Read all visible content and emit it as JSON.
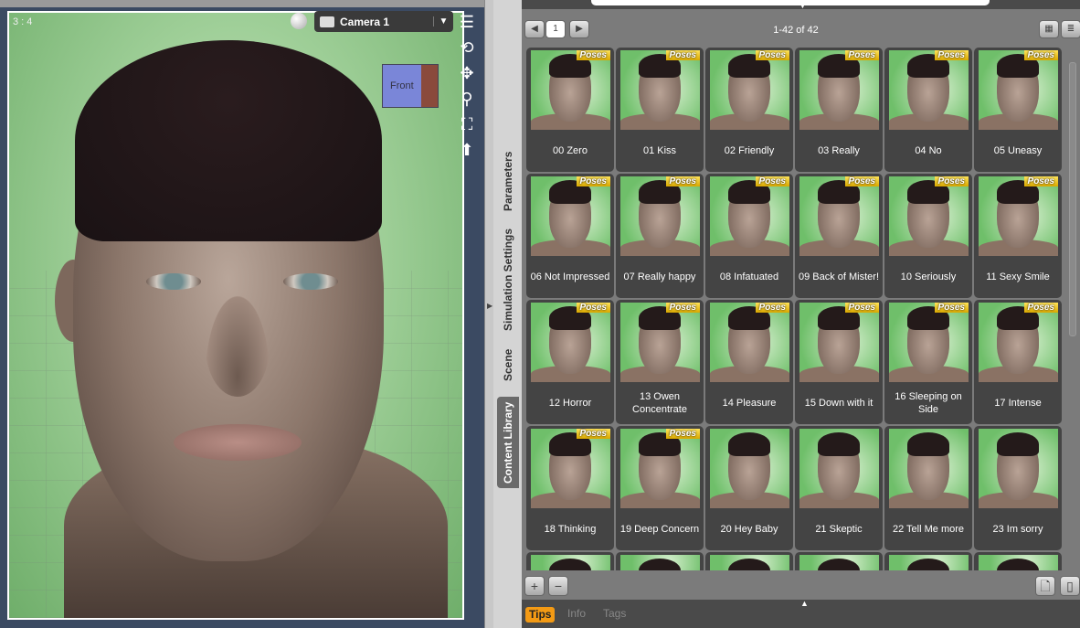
{
  "viewport": {
    "aspect_ratio": "3 : 4",
    "camera": "Camera 1",
    "nav_cube_label": "Front"
  },
  "side_tabs": [
    "Parameters",
    "Simulation Settings",
    "Scene",
    "Content Library"
  ],
  "active_side_tab": "Content Library",
  "library": {
    "page": "1",
    "count": "1-42 of 42",
    "badge": "Poses",
    "items": [
      {
        "label": "00 Zero",
        "pose": true
      },
      {
        "label": "01 Kiss",
        "pose": true
      },
      {
        "label": "02 Friendly",
        "pose": true
      },
      {
        "label": "03 Really",
        "pose": true
      },
      {
        "label": "04 No",
        "pose": true
      },
      {
        "label": "05 Uneasy",
        "pose": true
      },
      {
        "label": "06 Not Impressed",
        "pose": true
      },
      {
        "label": "07 Really happy",
        "pose": true
      },
      {
        "label": "08 Infatuated",
        "pose": true
      },
      {
        "label": "09 Back of Mister!",
        "pose": true
      },
      {
        "label": "10 Seriously",
        "pose": true
      },
      {
        "label": "11 Sexy Smile",
        "pose": true
      },
      {
        "label": "12  Horror",
        "pose": true
      },
      {
        "label": "13 Owen Concentrate",
        "pose": true
      },
      {
        "label": "14 Pleasure",
        "pose": true
      },
      {
        "label": "15 Down with it",
        "pose": true
      },
      {
        "label": "16 Sleeping on Side",
        "pose": true
      },
      {
        "label": "17 Intense",
        "pose": true
      },
      {
        "label": "18 Thinking",
        "pose": true
      },
      {
        "label": "19 Deep Concern",
        "pose": true
      },
      {
        "label": "20 Hey Baby",
        "pose": false
      },
      {
        "label": "21 Skeptic",
        "pose": false
      },
      {
        "label": "22 Tell Me more",
        "pose": false
      },
      {
        "label": "23 Im sorry",
        "pose": false
      },
      {
        "label": "",
        "pose": false
      },
      {
        "label": "",
        "pose": false
      },
      {
        "label": "",
        "pose": false
      },
      {
        "label": "",
        "pose": false
      },
      {
        "label": "",
        "pose": false
      },
      {
        "label": "",
        "pose": false
      }
    ]
  },
  "bottom_tabs": {
    "tips": "Tips",
    "info": "Info",
    "tags": "Tags",
    "active": "Tips"
  },
  "colors": {
    "badge": "#e0b000",
    "active_tab": "#f39a14",
    "viewport_frame": "#3b4a62"
  }
}
